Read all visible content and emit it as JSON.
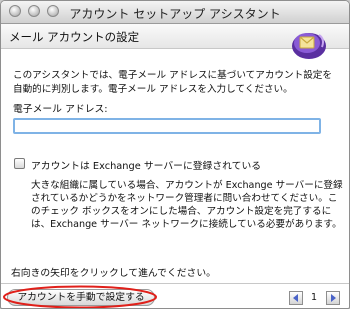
{
  "window": {
    "title": "アカウント セットアップ アシスタント",
    "header": "メール アカウントの設定"
  },
  "intro_text": "このアシスタントでは、電子メール アドレスに基づいてアカウント設定を自動的に判別します。電子メール アドレスを入力してください。",
  "email": {
    "label": "電子メール アドレス:",
    "value": ""
  },
  "exchange": {
    "checkbox_label": "アカウントは Exchange サーバーに登録されている",
    "checked": false,
    "description": "大きな組織に属している場合、アカウントが Exchange サーバーに登録されているかどうかをネットワーク管理者に問い合わせてください。このチェック ボックスをオンにした場合、アカウント設定を完了するには、Exchange サーバー ネットワークに接続している必要があります。"
  },
  "hint": "右向きの矢印をクリックして進んでください。",
  "footer": {
    "manual_button": "アカウントを手動で設定する",
    "page_number": "1"
  },
  "icons": {
    "logo": "entourage-logo-icon",
    "prev": "arrow-left-icon",
    "next": "arrow-right-icon"
  },
  "colors": {
    "accent": "#6a3fb0",
    "focus_ring": "#7fb3e6",
    "highlight_oval": "#e0201a",
    "arrow": "#4a63c8"
  }
}
